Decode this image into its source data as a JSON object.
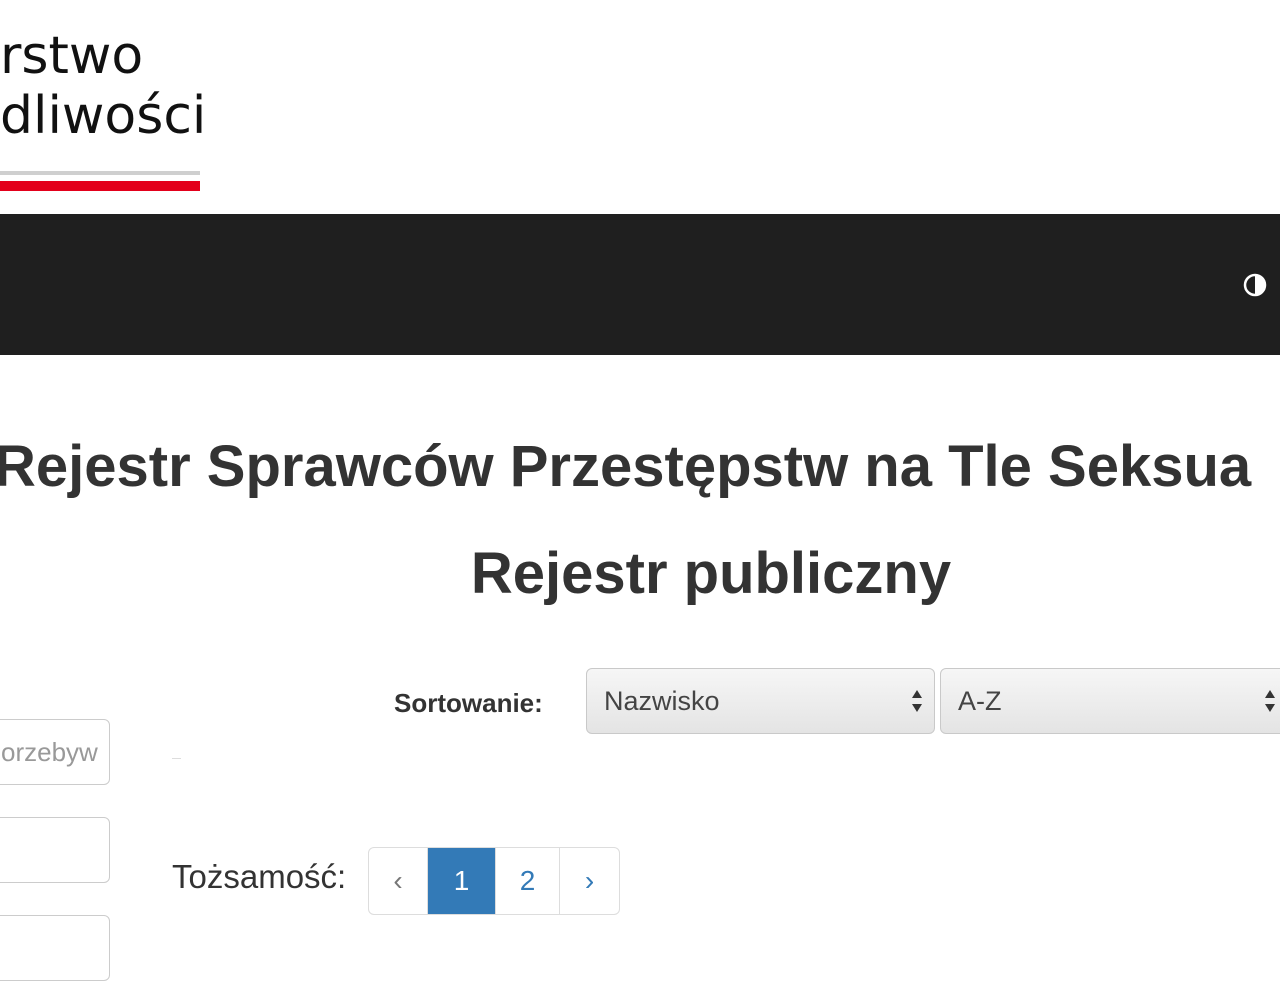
{
  "header": {
    "logo_line1": "rstwo",
    "logo_line2": "dliwości",
    "stripe_colors": {
      "grey": "#cfcfcf",
      "red": "#e3001b"
    }
  },
  "navbar": {
    "background": "#1f1f1f",
    "contrast_icon": "contrast-icon"
  },
  "main": {
    "title": "Rejestr Sprawców Przestępstw na Tle Seksua",
    "subtitle": "Rejestr publiczny"
  },
  "sorting": {
    "label": "Sortowanie:",
    "field_value": "Nazwisko",
    "order_value": "A-Z",
    "arrows_icon": "select-arrows-icon"
  },
  "filters": {
    "input1_placeholder": "orzebyw",
    "input2_placeholder": "",
    "input3_placeholder": ""
  },
  "pagination": {
    "label": "Tożsamość:",
    "prev": "‹",
    "pages": [
      "1",
      "2"
    ],
    "next": "›",
    "active_color": "#337ab7"
  }
}
